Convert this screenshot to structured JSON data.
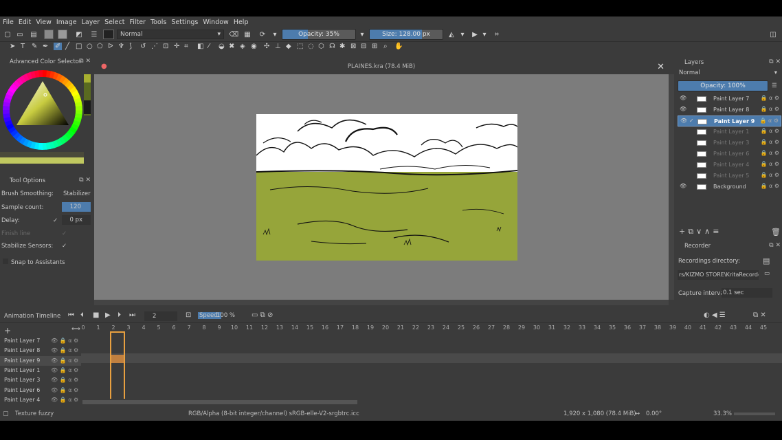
{
  "menu": [
    "File",
    "Edit",
    "View",
    "Image",
    "Layer",
    "Select",
    "Filter",
    "Tools",
    "Settings",
    "Window",
    "Help"
  ],
  "toolbar": {
    "blend_mode": "Normal",
    "opacity_label": "Opacity: 35%",
    "opacity_fraction": 0.35,
    "size_label": "Size: 128.00 px"
  },
  "colors": {
    "accent": "#4d7cad",
    "grass": "#96a53a",
    "panel": "#3b3b3b",
    "canvas_bg": "#7c7c7c",
    "frame_highlight": "#e8a040"
  },
  "color_selector": {
    "title": "Advanced Color Selector"
  },
  "tool_options": {
    "title": "Tool Options",
    "brush_smoothing_label": "Brush Smoothing:",
    "brush_smoothing_value": "Stabilizer",
    "sample_count_label": "Sample count:",
    "sample_count_value": "120",
    "delay_label": "Delay:",
    "delay_value": "0 px",
    "finish_line_label": "Finish line",
    "stabilize_label": "Stabilize Sensors:",
    "snap_label": "Snap to Assistants"
  },
  "document": {
    "title": "PLAINES.kra (78.4 MiB)"
  },
  "layers_panel": {
    "title": "Layers",
    "blend_mode": "Normal",
    "opacity_label": "Opacity: 100%",
    "layers": [
      {
        "name": "Paint Layer 7",
        "visible": true
      },
      {
        "name": "Paint Layer 8",
        "visible": true
      },
      {
        "name": "Paint Layer 9",
        "visible": true,
        "active": true
      },
      {
        "name": "Paint Layer 1",
        "visible": false
      },
      {
        "name": "Paint Layer 3",
        "visible": false
      },
      {
        "name": "Paint Layer 6",
        "visible": false
      },
      {
        "name": "Paint Layer 4",
        "visible": false
      },
      {
        "name": "Paint Layer 5",
        "visible": false
      },
      {
        "name": "Background",
        "visible": true
      }
    ]
  },
  "recorder": {
    "title": "Recorder",
    "dir_label": "Recordings directory:",
    "dir_value": "rs/KIZMO STORE\\KritaRecorder",
    "interval_label": "Capture interval:",
    "interval_value": "0.1 sec"
  },
  "timeline": {
    "title": "Animation Timeline",
    "current_frame": "2",
    "speed_label": "Speed:",
    "speed_value": "100 %",
    "frames": [
      "0",
      "1",
      "2",
      "3",
      "4",
      "5",
      "6",
      "7",
      "8",
      "9",
      "10",
      "11",
      "12",
      "13",
      "14",
      "15",
      "16",
      "17",
      "18",
      "19",
      "20",
      "21",
      "22",
      "23",
      "24",
      "25",
      "26",
      "27",
      "28",
      "29",
      "30",
      "31",
      "32",
      "33",
      "34",
      "35",
      "36",
      "37",
      "38",
      "39",
      "40",
      "41",
      "42",
      "43",
      "44",
      "45"
    ],
    "layers": [
      "Paint Layer 7",
      "Paint Layer 8",
      "Paint Layer 9",
      "Paint Layer 1",
      "Paint Layer 3",
      "Paint Layer 6",
      "Paint Layer 4"
    ]
  },
  "status": {
    "brush": "Texture fuzzy",
    "color_space": "RGB/Alpha (8-bit integer/channel)  sRGB-elle-V2-srgbtrc.icc",
    "dimensions": "1,920 x 1,080 (78.4 MiB)",
    "rotation": "0.00°",
    "zoom": "33.3%"
  }
}
